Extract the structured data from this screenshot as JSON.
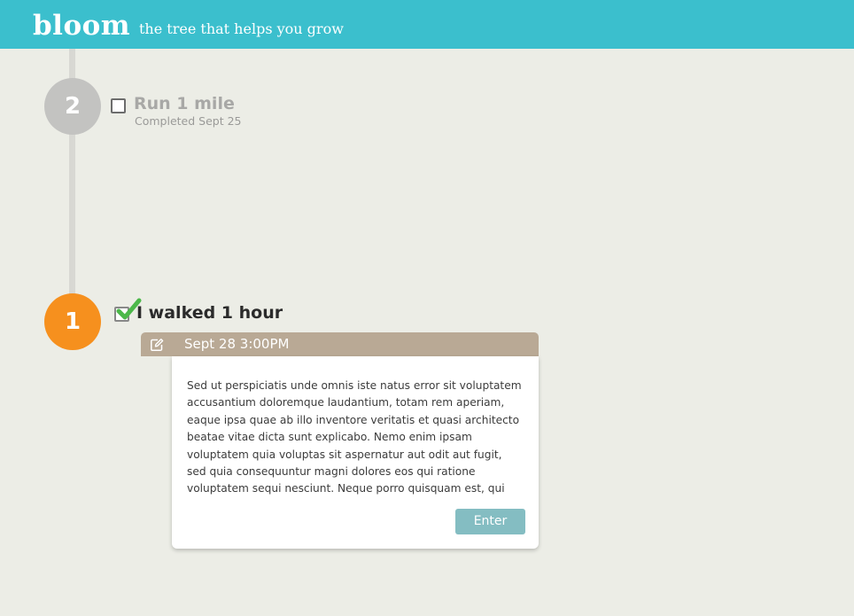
{
  "header": {
    "logo": "bloom",
    "tagline": "the tree that helps you grow"
  },
  "colors": {
    "header_bg": "#3bbfcd",
    "page_bg": "#ecede6",
    "step_done_circle": "#c3c3c1",
    "step_active_circle": "#f6901e",
    "card_header_bg": "#b9a995",
    "button_bg": "#84bdc2",
    "check_green": "#4cb84a"
  },
  "timeline": {
    "steps": [
      {
        "number": "2",
        "title": "Run 1 mile",
        "meta": "Completed Sept 25",
        "icon": "checkbox-icon"
      },
      {
        "number": "1",
        "title": "I walked 1 hour",
        "icon": "checkmark-icon",
        "entry": {
          "edit_icon": "edit-icon",
          "date": "Sept 28 3:00PM",
          "text": "Sed ut perspiciatis unde omnis iste natus error sit voluptatem accusantium doloremque laudantium, totam rem aperiam, eaque ipsa quae ab illo inventore veritatis et quasi architecto beatae vitae dicta sunt explicabo. Nemo enim ipsam voluptatem quia voluptas sit aspernatur aut odit aut fugit, sed quia consequuntur magni dolores eos qui ratione voluptatem sequi nesciunt. Neque porro quisquam est, qui dolorem",
          "button_label": "Enter"
        }
      }
    ]
  }
}
